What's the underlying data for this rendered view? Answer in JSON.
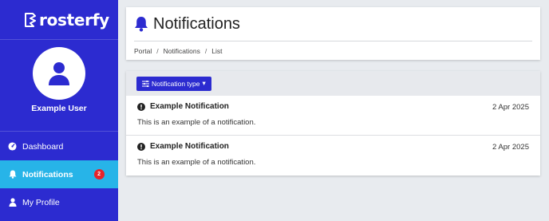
{
  "app": {
    "name": "rosterfy",
    "colors": {
      "primary": "#2c2bd0",
      "active": "#27b4e8",
      "badge": "#e8232a"
    }
  },
  "sidebar": {
    "logo_icon": "rosterfy-logo-icon",
    "user": {
      "name": "Example User",
      "avatar_icon": "user-icon"
    },
    "items": [
      {
        "label": "Dashboard",
        "icon": "dashboard-icon",
        "active": false
      },
      {
        "label": "Notifications",
        "icon": "bell-icon",
        "active": true,
        "badge": "2"
      },
      {
        "label": "My Profile",
        "icon": "user-icon",
        "active": false
      }
    ]
  },
  "header": {
    "title": "Notifications",
    "title_icon": "bell-icon",
    "breadcrumb": [
      "Portal",
      "Notifications",
      "List"
    ],
    "breadcrumb_separator": "/"
  },
  "toolbar": {
    "filter_label": "Notification type",
    "filter_icon": "sliders-icon",
    "filter_caret": "▾"
  },
  "notifications": [
    {
      "title": "Example Notification",
      "date": "2 Apr 2025",
      "body": "This is an example of a notification.",
      "icon": "exclamation-circle-icon"
    },
    {
      "title": "Example Notification",
      "date": "2 Apr 2025",
      "body": "This is an example of a notification.",
      "icon": "exclamation-circle-icon"
    }
  ]
}
